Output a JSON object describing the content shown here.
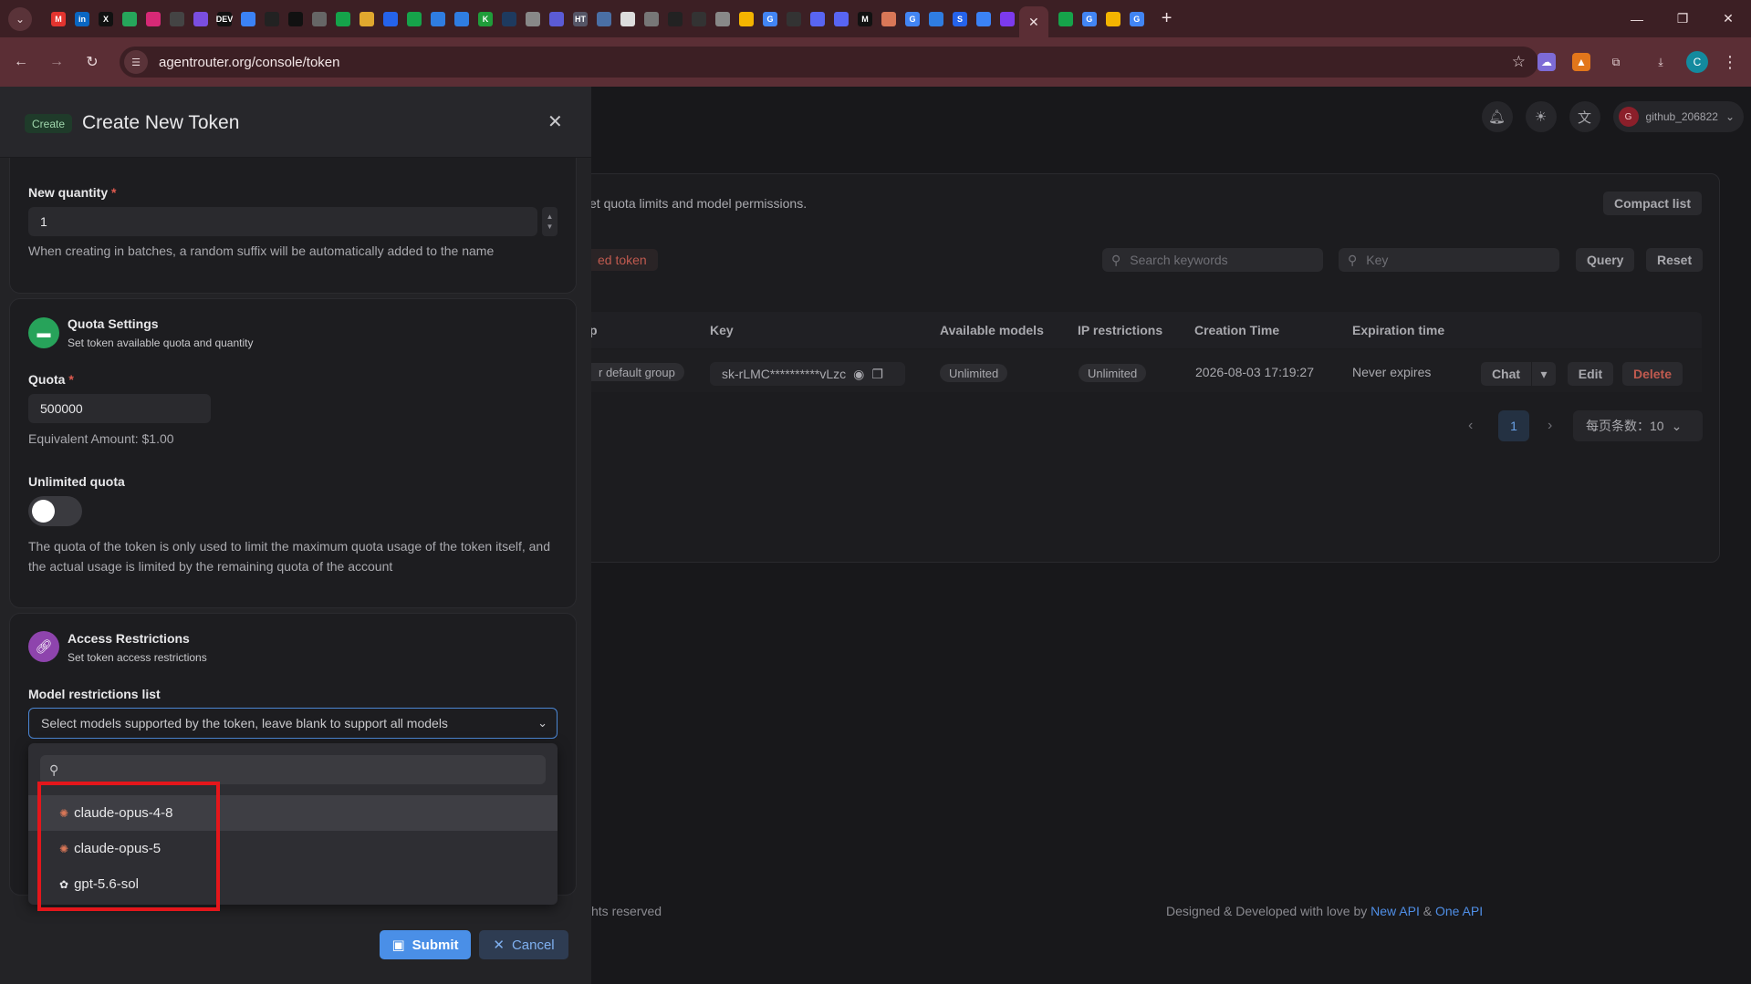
{
  "browser": {
    "url": "agentrouter.org/console/token",
    "active_tab_close": "✕",
    "new_tab": "+",
    "profile_initial": "C",
    "tab_favicons": [
      {
        "label": "M",
        "color": "#e3342f"
      },
      {
        "label": "in",
        "color": "#0a66c2"
      },
      {
        "label": "X",
        "color": "#111111"
      },
      {
        "label": "",
        "color": "#26a65b"
      },
      {
        "label": "",
        "color": "#d62976"
      },
      {
        "label": "",
        "color": "#444444"
      },
      {
        "label": "",
        "color": "#7a4ee0"
      },
      {
        "label": "DEV",
        "color": "#111111"
      },
      {
        "label": "",
        "color": "#3b82f6"
      },
      {
        "label": "",
        "color": "#222222"
      },
      {
        "label": "",
        "color": "#111111"
      },
      {
        "label": "",
        "color": "#666666"
      },
      {
        "label": "",
        "color": "#15a34a"
      },
      {
        "label": "",
        "color": "#e0a82e"
      },
      {
        "label": "",
        "color": "#2563eb"
      },
      {
        "label": "",
        "color": "#16a34a"
      },
      {
        "label": "",
        "color": "#2f7de1"
      },
      {
        "label": "",
        "color": "#2f7de1"
      },
      {
        "label": "K",
        "color": "#1f9d3a"
      },
      {
        "label": "",
        "color": "#1e3a5f"
      },
      {
        "label": "",
        "color": "#888888"
      },
      {
        "label": "",
        "color": "#5b5bd6"
      },
      {
        "label": "HT",
        "color": "#555566"
      },
      {
        "label": "",
        "color": "#4a6fa5"
      },
      {
        "label": "",
        "color": "#dddddd"
      },
      {
        "label": "",
        "color": "#777777"
      },
      {
        "label": "",
        "color": "#222222"
      },
      {
        "label": "",
        "color": "#333333"
      },
      {
        "label": "",
        "color": "#888888"
      },
      {
        "label": "",
        "color": "#f4b400"
      },
      {
        "label": "G",
        "color": "#4285f4"
      },
      {
        "label": "",
        "color": "#333333"
      },
      {
        "label": "",
        "color": "#5865f2"
      },
      {
        "label": "",
        "color": "#5865f2"
      },
      {
        "label": "M",
        "color": "#111111"
      },
      {
        "label": "",
        "color": "#d97757"
      },
      {
        "label": "G",
        "color": "#4285f4"
      },
      {
        "label": "",
        "color": "#2f7de1"
      },
      {
        "label": "S",
        "color": "#2563eb"
      },
      {
        "label": "",
        "color": "#3b82f6"
      },
      {
        "label": "",
        "color": "#7c3aed"
      }
    ],
    "tab_favicons_after": [
      {
        "label": "",
        "color": "#16a34a"
      },
      {
        "label": "G",
        "color": "#4285f4"
      },
      {
        "label": "",
        "color": "#f4b400"
      },
      {
        "label": "G",
        "color": "#4285f4"
      }
    ]
  },
  "page": {
    "user": {
      "avatar_initial": "G",
      "name": "github_206822"
    },
    "description": "et quota limits and model permissions.",
    "compact_list": "Compact list",
    "danger_action": "ed token",
    "search_placeholder": "Search keywords",
    "key_placeholder": "Key",
    "query": "Query",
    "reset": "Reset",
    "columns": {
      "group": "p",
      "key": "Key",
      "available_models": "Available models",
      "ip_restrictions": "IP restrictions",
      "creation_time": "Creation Time",
      "expiration_time": "Expiration time"
    },
    "row": {
      "group": "r default group",
      "key": "sk-rLMC**********vLzc",
      "available_models": "Unlimited",
      "ip_restrictions": "Unlimited",
      "creation_time": "2026-08-03 17:19:27",
      "expiration_time": "Never expires",
      "chat": "Chat",
      "edit": "Edit",
      "delete": "Delete"
    },
    "pagination": {
      "current_page": "1",
      "per_page": "每页条数：10"
    },
    "footer_left": "hts reserved",
    "footer_right_prefix": "Designed & Developed with love by",
    "footer_link1": "New API",
    "footer_amp": "&",
    "footer_link2": "One API"
  },
  "sheet": {
    "tag": "Create",
    "title": "Create New Token",
    "new_quantity": {
      "label": "New quantity",
      "value": "1",
      "hint": "When creating in batches, a random suffix will be automatically added to the name"
    },
    "quota_settings": {
      "title": "Quota Settings",
      "subtitle": "Set token available quota and quantity",
      "quota_label": "Quota",
      "quota_value": "500000",
      "equivalent": "Equivalent Amount: $1.00",
      "unlimited_label": "Unlimited quota",
      "unlimited_on": false,
      "note": "The quota of the token is only used to limit the maximum quota usage of the token itself, and the actual usage is limited by the remaining quota of the account"
    },
    "access_restrictions": {
      "title": "Access Restrictions",
      "subtitle": "Set token access restrictions",
      "model_label": "Model restrictions list",
      "model_placeholder": "Select models supported by the token, leave blank to support all models",
      "options": [
        {
          "label": "claude-opus-4-8",
          "icon": "anthropic-icon"
        },
        {
          "label": "claude-opus-5",
          "icon": "anthropic-icon"
        },
        {
          "label": "gpt-5.6-sol",
          "icon": "openai-icon"
        }
      ]
    },
    "submit": "Submit",
    "cancel": "Cancel"
  },
  "colors": {
    "accent_blue": "#4a8fe7",
    "danger_red": "#e05a4f",
    "highlight_red": "#e4161b",
    "quota_icon_green": "#27a35a",
    "access_icon_purple": "#8e44ad"
  }
}
